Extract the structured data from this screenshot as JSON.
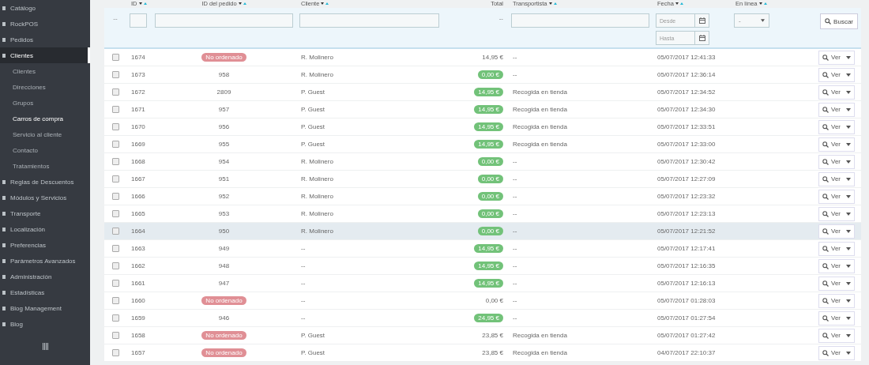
{
  "sidebar": {
    "items": [
      {
        "label": "Catálogo",
        "selected": false
      },
      {
        "label": "RockPOS",
        "selected": false
      },
      {
        "label": "Pedidos",
        "selected": false
      },
      {
        "label": "Clientes",
        "selected": true,
        "expanded": true,
        "children": [
          {
            "label": "Clientes",
            "selected": false
          },
          {
            "label": "Direcciones",
            "selected": false
          },
          {
            "label": "Grupos",
            "selected": false
          },
          {
            "label": "Carros de compra",
            "selected": true
          },
          {
            "label": "Servicio al cliente",
            "selected": false
          },
          {
            "label": "Contacto",
            "selected": false
          },
          {
            "label": "Tratamientos",
            "selected": false
          }
        ]
      },
      {
        "label": "Reglas de Descuentos",
        "selected": false
      },
      {
        "label": "Módulos y Servicios",
        "selected": false
      },
      {
        "label": "Transporte",
        "selected": false
      },
      {
        "label": "Localización",
        "selected": false
      },
      {
        "label": "Preferencias",
        "selected": false
      },
      {
        "label": "Parámetros Avanzados",
        "selected": false
      },
      {
        "label": "Administración",
        "selected": false
      },
      {
        "label": "Estadísticas",
        "selected": false
      },
      {
        "label": "Blog Management",
        "selected": false
      },
      {
        "label": "Blog",
        "selected": false
      }
    ]
  },
  "table": {
    "columns": [
      {
        "label": "ID",
        "sortable": true
      },
      {
        "label": "ID del pedido",
        "sortable": true
      },
      {
        "label": "Cliente",
        "sortable": true
      },
      {
        "label": "Total",
        "sortable": false
      },
      {
        "label": "Transportista",
        "sortable": true
      },
      {
        "label": "Fecha",
        "sortable": true
      },
      {
        "label": "En línea",
        "sortable": true
      }
    ],
    "filters": {
      "checkbox": "--",
      "total": "--",
      "date_from": {
        "placeholder": "Desde"
      },
      "date_to": {
        "placeholder": "Hasta"
      },
      "online": "-",
      "search_button": "Buscar"
    },
    "rows": [
      {
        "id": "1674",
        "order": {
          "kind": "badge",
          "text": "No ordenado"
        },
        "customer": "R. Molinero",
        "total": {
          "kind": "plain",
          "text": "14,95 €"
        },
        "carrier": "--",
        "date": "05/07/2017 12:41:33",
        "hovered": false,
        "action": "Ver"
      },
      {
        "id": "1673",
        "order": {
          "kind": "plain",
          "text": "958"
        },
        "customer": "R. Molinero",
        "total": {
          "kind": "badge",
          "text": "0,00 €"
        },
        "carrier": "--",
        "date": "05/07/2017 12:36:14",
        "hovered": false,
        "action": "Ver"
      },
      {
        "id": "1672",
        "order": {
          "kind": "plain",
          "text": "2809"
        },
        "customer": "P. Guest",
        "total": {
          "kind": "badge",
          "text": "14,95 €"
        },
        "carrier": "Recogida en tienda",
        "date": "05/07/2017 12:34:52",
        "hovered": false,
        "action": "Ver"
      },
      {
        "id": "1671",
        "order": {
          "kind": "plain",
          "text": "957"
        },
        "customer": "P. Guest",
        "total": {
          "kind": "badge",
          "text": "14,95 €"
        },
        "carrier": "Recogida en tienda",
        "date": "05/07/2017 12:34:30",
        "hovered": false,
        "action": "Ver"
      },
      {
        "id": "1670",
        "order": {
          "kind": "plain",
          "text": "956"
        },
        "customer": "P. Guest",
        "total": {
          "kind": "badge",
          "text": "14,95 €"
        },
        "carrier": "Recogida en tienda",
        "date": "05/07/2017 12:33:51",
        "hovered": false,
        "action": "Ver"
      },
      {
        "id": "1669",
        "order": {
          "kind": "plain",
          "text": "955"
        },
        "customer": "P. Guest",
        "total": {
          "kind": "badge",
          "text": "14,95 €"
        },
        "carrier": "Recogida en tienda",
        "date": "05/07/2017 12:33:00",
        "hovered": false,
        "action": "Ver"
      },
      {
        "id": "1668",
        "order": {
          "kind": "plain",
          "text": "954"
        },
        "customer": "R. Molinero",
        "total": {
          "kind": "badge",
          "text": "0,00 €"
        },
        "carrier": "--",
        "date": "05/07/2017 12:30:42",
        "hovered": false,
        "action": "Ver"
      },
      {
        "id": "1667",
        "order": {
          "kind": "plain",
          "text": "951"
        },
        "customer": "R. Molinero",
        "total": {
          "kind": "badge",
          "text": "0,00 €"
        },
        "carrier": "--",
        "date": "05/07/2017 12:27:09",
        "hovered": false,
        "action": "Ver"
      },
      {
        "id": "1666",
        "order": {
          "kind": "plain",
          "text": "952"
        },
        "customer": "R. Molinero",
        "total": {
          "kind": "badge",
          "text": "0,00 €"
        },
        "carrier": "--",
        "date": "05/07/2017 12:23:32",
        "hovered": false,
        "action": "Ver"
      },
      {
        "id": "1665",
        "order": {
          "kind": "plain",
          "text": "953"
        },
        "customer": "R. Molinero",
        "total": {
          "kind": "badge",
          "text": "0,00 €"
        },
        "carrier": "--",
        "date": "05/07/2017 12:23:13",
        "hovered": false,
        "action": "Ver"
      },
      {
        "id": "1664",
        "order": {
          "kind": "plain",
          "text": "950"
        },
        "customer": "R. Molinero",
        "total": {
          "kind": "badge",
          "text": "0,00 €"
        },
        "carrier": "--",
        "date": "05/07/2017 12:21:52",
        "hovered": true,
        "action": "Ver"
      },
      {
        "id": "1663",
        "order": {
          "kind": "plain",
          "text": "949"
        },
        "customer": "--",
        "total": {
          "kind": "badge",
          "text": "14,95 €"
        },
        "carrier": "--",
        "date": "05/07/2017 12:17:41",
        "hovered": false,
        "action": "Ver"
      },
      {
        "id": "1662",
        "order": {
          "kind": "plain",
          "text": "948"
        },
        "customer": "--",
        "total": {
          "kind": "badge",
          "text": "14,95 €"
        },
        "carrier": "--",
        "date": "05/07/2017 12:16:35",
        "hovered": false,
        "action": "Ver"
      },
      {
        "id": "1661",
        "order": {
          "kind": "plain",
          "text": "947"
        },
        "customer": "--",
        "total": {
          "kind": "badge",
          "text": "14,95 €"
        },
        "carrier": "--",
        "date": "05/07/2017 12:16:13",
        "hovered": false,
        "action": "Ver"
      },
      {
        "id": "1660",
        "order": {
          "kind": "badge",
          "text": "No ordenado"
        },
        "customer": "--",
        "total": {
          "kind": "plain",
          "text": "0,00 €"
        },
        "carrier": "--",
        "date": "05/07/2017 01:28:03",
        "hovered": false,
        "action": "Ver"
      },
      {
        "id": "1659",
        "order": {
          "kind": "plain",
          "text": "946"
        },
        "customer": "--",
        "total": {
          "kind": "badge",
          "text": "24,95 €"
        },
        "carrier": "--",
        "date": "05/07/2017 01:27:54",
        "hovered": false,
        "action": "Ver"
      },
      {
        "id": "1658",
        "order": {
          "kind": "badge",
          "text": "No ordenado"
        },
        "customer": "P. Guest",
        "total": {
          "kind": "plain",
          "text": "23,85 €"
        },
        "carrier": "Recogida en tienda",
        "date": "05/07/2017 01:27:42",
        "hovered": false,
        "action": "Ver"
      },
      {
        "id": "1657",
        "order": {
          "kind": "badge",
          "text": "No ordenado"
        },
        "customer": "P. Guest",
        "total": {
          "kind": "plain",
          "text": "23,85 €"
        },
        "carrier": "Recogida en tienda",
        "date": "04/07/2017 22:10:37",
        "hovered": false,
        "action": "Ver"
      }
    ]
  }
}
